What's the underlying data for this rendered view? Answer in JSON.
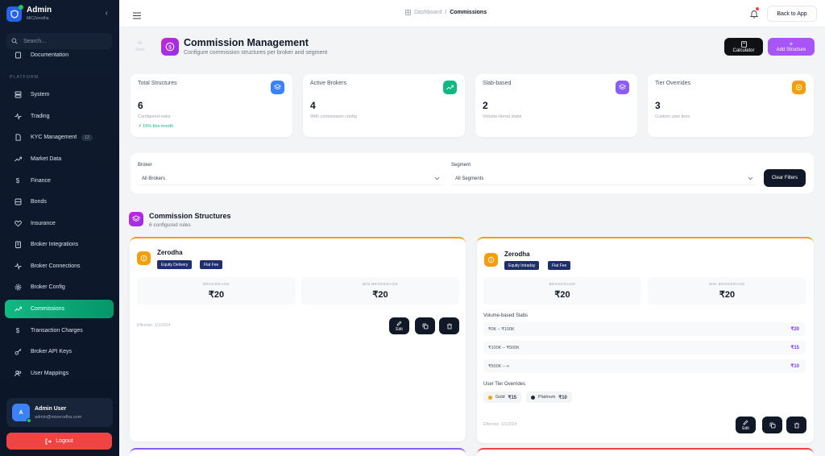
{
  "sidebar": {
    "app_title": "Admin",
    "app_subtitle": "MiCZerodha",
    "search_placeholder": "Search...",
    "partial_item": "Documentation",
    "section_label": "PLATFORM",
    "items": [
      {
        "label": "System",
        "icon": "server-icon"
      },
      {
        "label": "Trading",
        "icon": "activity-icon"
      },
      {
        "label": "KYC Management",
        "icon": "file-check-icon",
        "badge": "12"
      },
      {
        "label": "Market Data",
        "icon": "trending-up-icon"
      },
      {
        "label": "Finance",
        "icon": "dollar-icon"
      },
      {
        "label": "Bonds",
        "icon": "layers-icon"
      },
      {
        "label": "Insurance",
        "icon": "heart-icon"
      },
      {
        "label": "Broker Integrations",
        "icon": "building-icon"
      },
      {
        "label": "Broker Connections",
        "icon": "activity-icon"
      },
      {
        "label": "Broker Config",
        "icon": "gear-icon"
      },
      {
        "label": "Commissions",
        "icon": "trending-up-icon",
        "active": true
      },
      {
        "label": "Transaction Charges",
        "icon": "dollar-icon"
      },
      {
        "label": "Broker API Keys",
        "icon": "key-icon"
      },
      {
        "label": "User Mappings",
        "icon": "users-icon"
      }
    ],
    "user": {
      "initial": "A",
      "name": "Admin User",
      "email": "admin@mizerodha.com"
    },
    "logout_label": "Logout"
  },
  "topbar": {
    "breadcrumb_home": "Dashboard",
    "breadcrumb_current": "Commissions",
    "back_label": "Back to App"
  },
  "header": {
    "ghost_text": [
      "At",
      "Save"
    ],
    "title": "Commission Management",
    "subtitle": "Configure commission structures per broker and segment",
    "calculator_label": "Calculator",
    "add_label": "Add Structure"
  },
  "stats": [
    {
      "label": "Total Structures",
      "value": "6",
      "sub": "Configured rules",
      "trend": "15% this month",
      "color": "#3b82f6",
      "icon": "layers-icon"
    },
    {
      "label": "Active Brokers",
      "value": "4",
      "sub": "With commission config",
      "color": "#10b981",
      "icon": "trending-up-icon"
    },
    {
      "label": "Slab-based",
      "value": "2",
      "sub": "Volume-tiered slabs",
      "color": "#8b5cf6",
      "icon": "layers-icon"
    },
    {
      "label": "Tier Overrides",
      "value": "3",
      "sub": "Custom user tiers",
      "color": "#f59e0b",
      "icon": "star-icon"
    }
  ],
  "filters": {
    "broker_label": "Broker",
    "broker_value": "All Brokers",
    "segment_label": "Segment",
    "segment_value": "All Segments",
    "clear_label": "Clear Filters"
  },
  "section": {
    "title": "Commission Structures",
    "subtitle": "6 configured rules"
  },
  "cards": [
    {
      "broker": "Zerodha",
      "tags": [
        "Equity Delivery",
        "Flat Fee"
      ],
      "brokerage_label": "BROKERAGE",
      "brokerage": "₹20",
      "min_label": "MIN BROKERAGE",
      "min": "₹20",
      "effective": "Effective: 1/1/2024",
      "edit_label": "Edit"
    },
    {
      "broker": "Zerodha",
      "tags": [
        "Equity Intraday",
        "Flat Fee"
      ],
      "brokerage_label": "BROKERAGE",
      "brokerage": "₹20",
      "min_label": "MIN BROKERAGE",
      "min": "₹20",
      "slabs_label": "Volume-based Slabs",
      "slabs": [
        {
          "range": "₹0K – ₹100K",
          "value": "₹20"
        },
        {
          "range": "₹100K – ₹500K",
          "value": "₹15"
        },
        {
          "range": "₹500K – ∞",
          "value": "₹10"
        }
      ],
      "tiers_label": "User Tier Overrides",
      "tiers": [
        {
          "name": "Gold",
          "value": "₹15",
          "color": "#f59e0b"
        },
        {
          "name": "Platinum",
          "value": "₹10",
          "color": "#1f2937"
        }
      ],
      "effective": "Effective: 1/1/2024",
      "edit_label": "Edit"
    }
  ],
  "colors": {
    "accent": "#10b981",
    "brand": "#2563eb",
    "purple": "#a855f7",
    "danger": "#ef4444"
  }
}
